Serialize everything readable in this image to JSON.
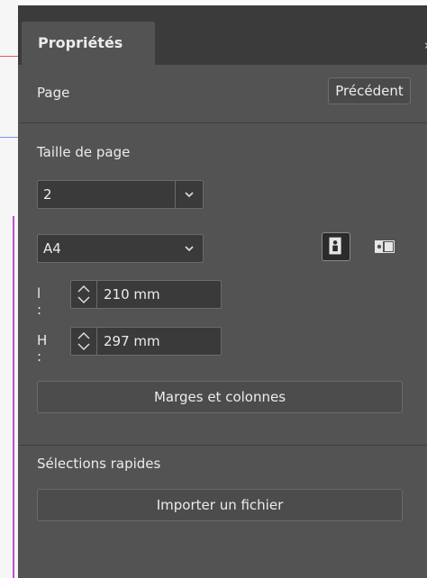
{
  "panel": {
    "tab_label": "Propriétés",
    "collapse_glyph": "»",
    "section_label": "Page",
    "previous_label": "Précédent"
  },
  "page_size": {
    "heading": "Taille de page",
    "count_value": "2",
    "preset_value": "A4",
    "width_label": "l :",
    "width_value": "210 mm",
    "height_label": "H :",
    "height_value": "297 mm",
    "orientation_selected": "portrait",
    "margins_button": "Marges et colonnes"
  },
  "quick_actions": {
    "heading": "Sélections rapides",
    "import_button": "Importer un fichier"
  },
  "icons": {
    "dropdown": "chevron-down-icon",
    "spinner": "stepper-arrows-icon",
    "portrait": "portrait-orientation-icon",
    "landscape": "landscape-orientation-icon"
  },
  "colors": {
    "panel_bg": "#535353",
    "tabbar_bg": "#3b3b3b",
    "field_bg": "#3a3a3a",
    "text": "#ececec"
  }
}
